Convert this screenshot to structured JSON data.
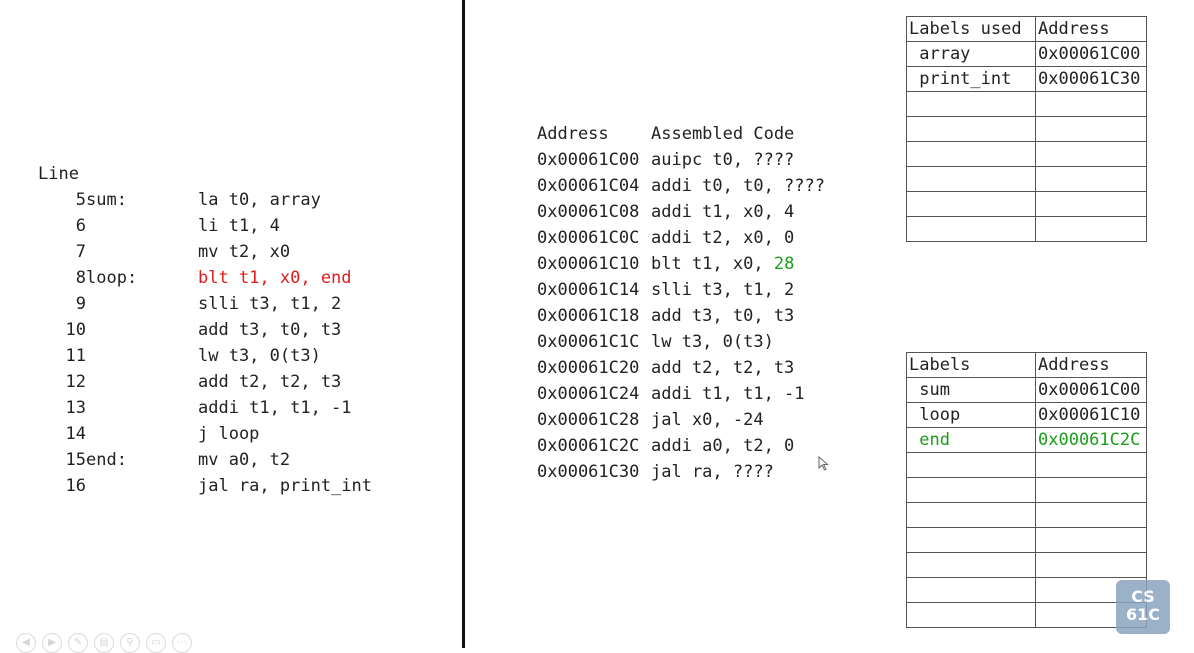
{
  "source": {
    "header": "Line",
    "rows": [
      {
        "line": "5",
        "label": "sum:",
        "code": "la t0, array",
        "highlight": ""
      },
      {
        "line": "6",
        "label": "",
        "code": "li t1, 4",
        "highlight": ""
      },
      {
        "line": "7",
        "label": "",
        "code": "mv t2, x0",
        "highlight": ""
      },
      {
        "line": "8",
        "label": "loop:",
        "code": "blt t1, x0, end",
        "highlight": "red"
      },
      {
        "line": "9",
        "label": "",
        "code": "slli t3, t1, 2",
        "highlight": ""
      },
      {
        "line": "10",
        "label": "",
        "code": "add t3, t0, t3",
        "highlight": ""
      },
      {
        "line": "11",
        "label": "",
        "code": "lw t3, 0(t3)",
        "highlight": ""
      },
      {
        "line": "12",
        "label": "",
        "code": "add t2, t2, t3",
        "highlight": ""
      },
      {
        "line": "13",
        "label": "",
        "code": "addi t1, t1, -1",
        "highlight": ""
      },
      {
        "line": "14",
        "label": "",
        "code": "j loop",
        "highlight": ""
      },
      {
        "line": "15",
        "label": "end:",
        "code": "mv a0, t2",
        "highlight": ""
      },
      {
        "line": "16",
        "label": "",
        "code": "jal ra, print_int",
        "highlight": ""
      }
    ]
  },
  "assembled": {
    "header_address": "Address",
    "header_code": "Assembled Code",
    "rows": [
      {
        "address": "0x00061C00",
        "code": "auipc t0, ????",
        "green": ""
      },
      {
        "address": "0x00061C04",
        "code": "addi t0, t0, ????",
        "green": ""
      },
      {
        "address": "0x00061C08",
        "code": "addi t1, x0, 4",
        "green": ""
      },
      {
        "address": "0x00061C0C",
        "code": "addi t2, x0, 0",
        "green": ""
      },
      {
        "address": "0x00061C10",
        "code": "blt t1, x0, ",
        "green": "28"
      },
      {
        "address": "0x00061C14",
        "code": "slli t3, t1, 2",
        "green": ""
      },
      {
        "address": "0x00061C18",
        "code": "add t3, t0, t3",
        "green": ""
      },
      {
        "address": "0x00061C1C",
        "code": "lw t3, 0(t3)",
        "green": ""
      },
      {
        "address": "0x00061C20",
        "code": "add t2, t2, t3",
        "green": ""
      },
      {
        "address": "0x00061C24",
        "code": "addi t1, t1, -1",
        "green": ""
      },
      {
        "address": "0x00061C28",
        "code": "jal x0, -24",
        "green": ""
      },
      {
        "address": "0x00061C2C",
        "code": "addi a0, t2, 0",
        "green": ""
      },
      {
        "address": "0x00061C30",
        "code": "jal ra, ????",
        "green": ""
      }
    ]
  },
  "labels_used_table": {
    "header": [
      "Labels used",
      "Address"
    ],
    "rows": [
      {
        "label": " array",
        "address": "0x00061C00",
        "highlight": ""
      },
      {
        "label": " print_int",
        "address": "0x00061C30",
        "highlight": ""
      },
      {
        "label": "",
        "address": "",
        "highlight": ""
      },
      {
        "label": "",
        "address": "",
        "highlight": ""
      },
      {
        "label": "",
        "address": "",
        "highlight": ""
      },
      {
        "label": "",
        "address": "",
        "highlight": ""
      },
      {
        "label": "",
        "address": "",
        "highlight": ""
      },
      {
        "label": "",
        "address": "",
        "highlight": ""
      }
    ]
  },
  "labels_table": {
    "header": [
      "Labels",
      "Address"
    ],
    "rows": [
      {
        "label": " sum",
        "address": "0x00061C00",
        "highlight": ""
      },
      {
        "label": " loop",
        "address": "0x00061C10",
        "highlight": ""
      },
      {
        "label": " end",
        "address": "0x00061C2C",
        "highlight": "green"
      },
      {
        "label": "",
        "address": "",
        "highlight": ""
      },
      {
        "label": "",
        "address": "",
        "highlight": ""
      },
      {
        "label": "",
        "address": "",
        "highlight": ""
      },
      {
        "label": "",
        "address": "",
        "highlight": ""
      },
      {
        "label": "",
        "address": "",
        "highlight": ""
      },
      {
        "label": "",
        "address": "",
        "highlight": ""
      },
      {
        "label": "",
        "address": "",
        "highlight": ""
      }
    ]
  },
  "logo": {
    "line1": "CS",
    "line2": "61C"
  },
  "colors": {
    "red": "#e01b1b",
    "green": "#1a9e1a"
  }
}
